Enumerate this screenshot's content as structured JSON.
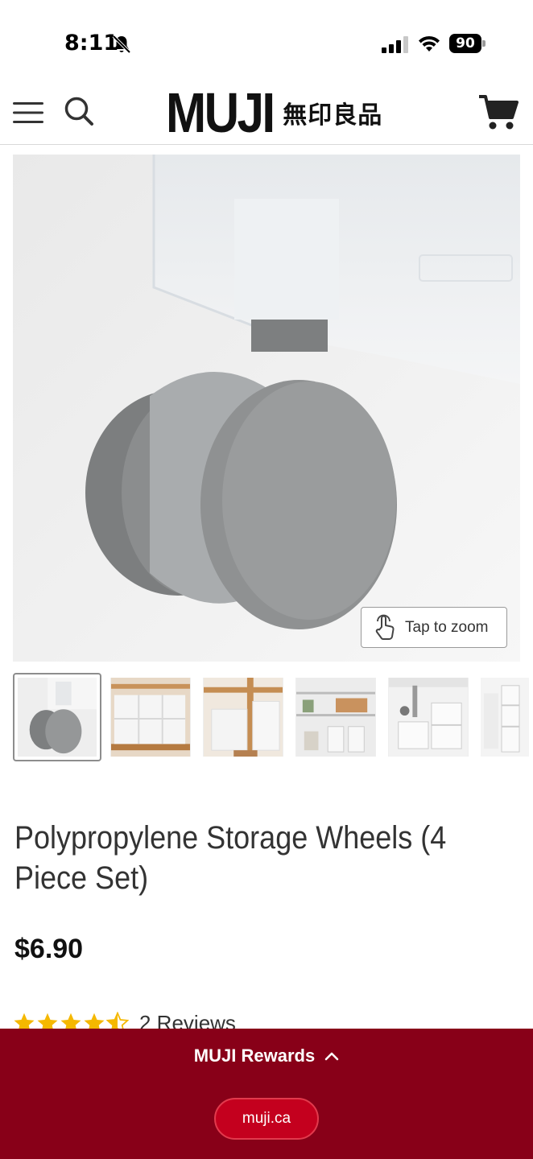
{
  "status_bar": {
    "time": "8:11",
    "battery": "90"
  },
  "header": {
    "logo": "MUJI",
    "logo_japanese": "無印良品"
  },
  "gallery": {
    "zoom_label": "Tap to zoom",
    "thumbnail_count": 6
  },
  "product": {
    "title": "Polypropylene Storage Wheels (4 Piece Set)",
    "price": "$6.90",
    "rating": 4.5,
    "rating_max": 5,
    "reviews": "2 Reviews"
  },
  "rewards": {
    "label": "MUJI Rewards",
    "site": "muji.ca"
  },
  "colors": {
    "star": "#f5b800",
    "rewards_bg": "#880018",
    "pill_bg": "#c4001e"
  }
}
